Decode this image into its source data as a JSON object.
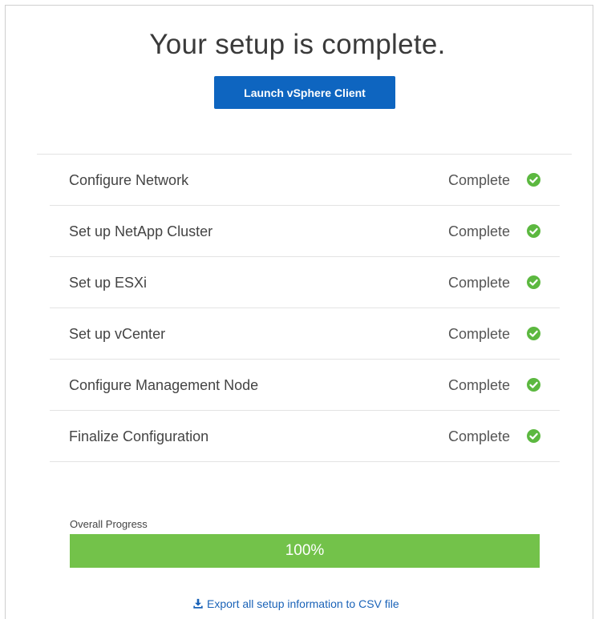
{
  "header": {
    "title": "Your setup is complete.",
    "launch_label": "Launch vSphere Client"
  },
  "steps": [
    {
      "label": "Configure Network",
      "status": "Complete"
    },
    {
      "label": "Set up NetApp Cluster",
      "status": "Complete"
    },
    {
      "label": "Set up ESXi",
      "status": "Complete"
    },
    {
      "label": "Set up vCenter",
      "status": "Complete"
    },
    {
      "label": "Configure Management Node",
      "status": "Complete"
    },
    {
      "label": "Finalize Configuration",
      "status": "Complete"
    }
  ],
  "progress": {
    "label": "Overall Progress",
    "value_text": "100%",
    "fraction": 1.0
  },
  "export": {
    "label": "Export all setup information to CSV file",
    "icon": "download-icon"
  },
  "colors": {
    "accent": "#0e65c0",
    "success": "#73c24a",
    "check": "#5cb840",
    "link": "#1a63b8"
  }
}
